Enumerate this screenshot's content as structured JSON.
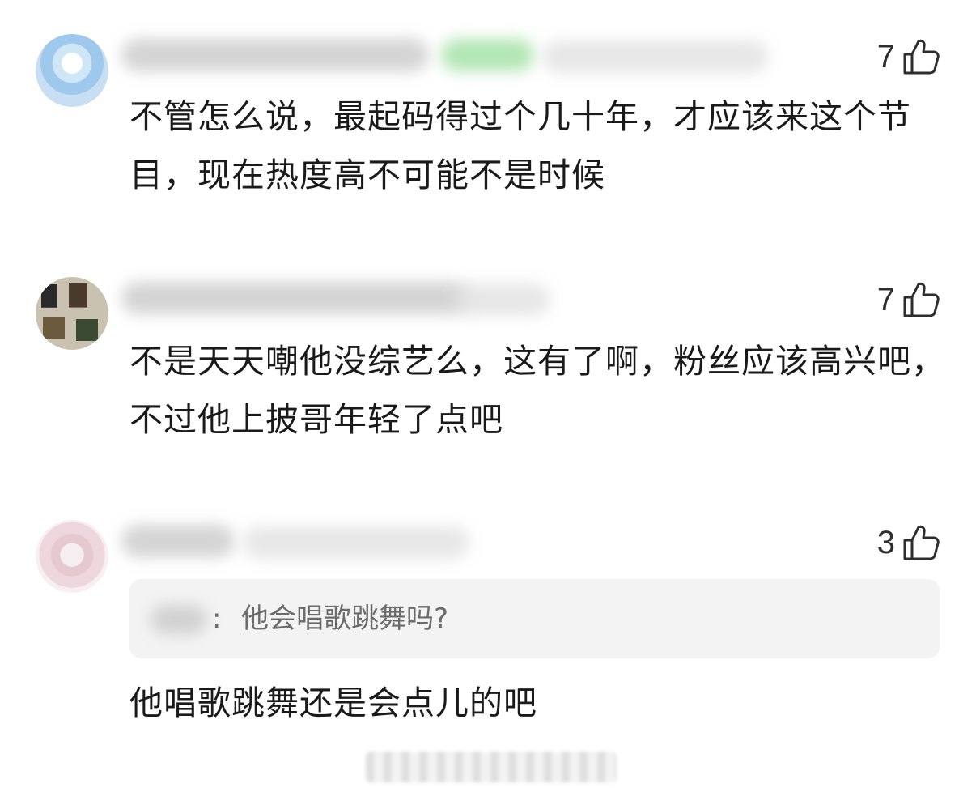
{
  "comments": [
    {
      "likes": "7",
      "text": "不管怎么说，最起码得过个几十年，才应该来这个节目，现在热度高不可能不是时候"
    },
    {
      "likes": "7",
      "text": "不是天天嘲他没综艺么，这有了啊，粉丝应该高兴吧，不过他上披哥年轻了点吧"
    },
    {
      "likes": "3",
      "quote": {
        "separator": ":",
        "text": "他会唱歌跳舞吗?"
      },
      "text": "他唱歌跳舞还是会点儿的吧"
    }
  ],
  "icons": {
    "like": "thumbs-up-icon"
  },
  "colors": {
    "text": "#1a1a1a",
    "like_count": "#2e2e2e",
    "quote_background": "#f3f3f3",
    "quote_text": "#6b6b6b"
  }
}
